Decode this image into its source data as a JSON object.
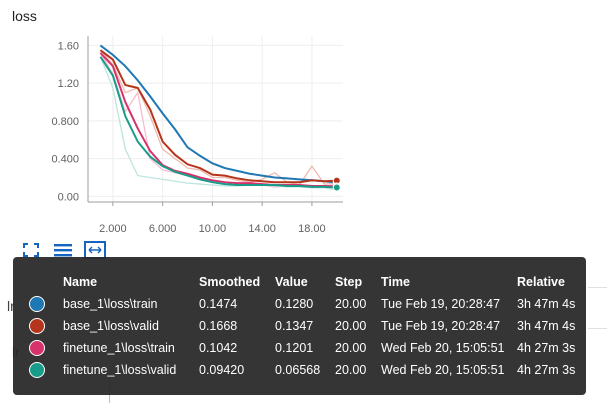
{
  "card": {
    "title": "loss"
  },
  "chart_data": {
    "type": "line",
    "title": "loss",
    "xlim": [
      0,
      20.5
    ],
    "ylim": [
      -0.06,
      1.7
    ],
    "xticks": [
      2,
      6,
      10,
      14,
      18
    ],
    "xtick_labels": [
      "2.000",
      "6.000",
      "10.00",
      "14.00",
      "18.00"
    ],
    "yticks": [
      0.0,
      0.4,
      0.8,
      1.2,
      1.6
    ],
    "ytick_labels": [
      "0.00",
      "0.400",
      "0.800",
      "1.20",
      "1.60"
    ],
    "grid": true,
    "series": [
      {
        "name": "base_1\\loss\\train",
        "color": "#1f77b4",
        "raw_color": "#9ec8e3",
        "x": [
          1,
          2,
          3,
          4,
          5,
          6,
          7,
          8,
          9,
          10,
          11,
          12,
          13,
          14,
          15,
          16,
          17,
          18,
          19,
          20
        ],
        "values": [
          1.6,
          1.5,
          1.38,
          1.23,
          1.06,
          0.88,
          0.71,
          0.52,
          0.43,
          0.35,
          0.3,
          0.27,
          0.24,
          0.22,
          0.2,
          0.19,
          0.18,
          0.17,
          0.16,
          0.15
        ],
        "raw": [
          1.6,
          1.5,
          1.38,
          1.23,
          1.06,
          0.88,
          0.71,
          0.52,
          0.43,
          0.35,
          0.3,
          0.27,
          0.24,
          0.22,
          0.2,
          0.19,
          0.18,
          0.17,
          0.16,
          0.128
        ]
      },
      {
        "name": "base_1\\loss\\valid",
        "color": "#b5351c",
        "raw_color": "#f1b3a6",
        "x": [
          1,
          2,
          3,
          4,
          5,
          6,
          7,
          8,
          9,
          10,
          11,
          12,
          13,
          14,
          15,
          16,
          17,
          18,
          19,
          20
        ],
        "values": [
          1.55,
          1.45,
          1.18,
          1.15,
          0.92,
          0.58,
          0.44,
          0.34,
          0.3,
          0.23,
          0.22,
          0.19,
          0.17,
          0.16,
          0.15,
          0.15,
          0.15,
          0.17,
          0.16,
          0.167
        ],
        "raw": [
          1.55,
          1.4,
          1.1,
          1.15,
          0.85,
          0.5,
          0.4,
          0.3,
          0.28,
          0.2,
          0.2,
          0.17,
          0.15,
          0.18,
          0.25,
          0.15,
          0.12,
          0.32,
          0.13,
          0.135
        ]
      },
      {
        "name": "finetune_1\\loss\\train",
        "color": "#d6336c",
        "raw_color": "#f4b6cb",
        "x": [
          1,
          2,
          3,
          4,
          5,
          6,
          7,
          8,
          9,
          10,
          11,
          12,
          13,
          14,
          15,
          16,
          17,
          18,
          19,
          20
        ],
        "values": [
          1.52,
          1.38,
          1.0,
          0.72,
          0.48,
          0.33,
          0.27,
          0.24,
          0.2,
          0.17,
          0.15,
          0.14,
          0.14,
          0.13,
          0.12,
          0.12,
          0.12,
          0.11,
          0.11,
          0.104
        ],
        "raw": [
          1.52,
          1.3,
          0.9,
          1.1,
          0.4,
          0.28,
          0.25,
          0.22,
          0.18,
          0.15,
          0.13,
          0.12,
          0.13,
          0.12,
          0.1,
          0.11,
          0.12,
          0.1,
          0.11,
          0.12
        ]
      },
      {
        "name": "finetune_1\\loss\\valid",
        "color": "#1a9c8a",
        "raw_color": "#b5e2da",
        "x": [
          1,
          2,
          3,
          4,
          5,
          6,
          7,
          8,
          9,
          10,
          11,
          12,
          13,
          14,
          15,
          16,
          17,
          18,
          19,
          20
        ],
        "values": [
          1.48,
          1.28,
          0.85,
          0.58,
          0.42,
          0.32,
          0.26,
          0.22,
          0.18,
          0.15,
          0.13,
          0.12,
          0.12,
          0.12,
          0.12,
          0.11,
          0.11,
          0.1,
          0.1,
          0.094
        ],
        "raw": [
          1.48,
          1.15,
          0.5,
          0.22,
          0.2,
          0.18,
          0.16,
          0.14,
          0.13,
          0.12,
          0.11,
          0.11,
          0.12,
          0.12,
          0.11,
          0.1,
          0.1,
          0.09,
          0.09,
          0.066
        ]
      }
    ]
  },
  "toolbar": {
    "icons": [
      "fullscreen-icon",
      "list-icon",
      "fit-domain-icon"
    ]
  },
  "underlay": {
    "label1": "lr",
    "label2": "lr"
  },
  "tooltip": {
    "headers": {
      "name": "Name",
      "smoothed": "Smoothed",
      "value": "Value",
      "step": "Step",
      "time": "Time",
      "relative": "Relative"
    },
    "rows": [
      {
        "color": "#1f77b4",
        "name": "base_1\\loss\\train",
        "smoothed": "0.1474",
        "value": "0.1280",
        "step": "20.00",
        "time": "Tue Feb 19, 20:28:47",
        "relative": "3h 47m 4s"
      },
      {
        "color": "#b5351c",
        "name": "base_1\\loss\\valid",
        "smoothed": "0.1668",
        "value": "0.1347",
        "step": "20.00",
        "time": "Tue Feb 19, 20:28:47",
        "relative": "3h 47m 4s"
      },
      {
        "color": "#d6336c",
        "name": "finetune_1\\loss\\train",
        "smoothed": "0.1042",
        "value": "0.1201",
        "step": "20.00",
        "time": "Wed Feb 20, 15:05:51",
        "relative": "4h 27m 3s"
      },
      {
        "color": "#1a9c8a",
        "name": "finetune_1\\loss\\valid",
        "smoothed": "0.09420",
        "value": "0.06568",
        "step": "20.00",
        "time": "Wed Feb 20, 15:05:51",
        "relative": "4h 27m 3s"
      }
    ]
  }
}
